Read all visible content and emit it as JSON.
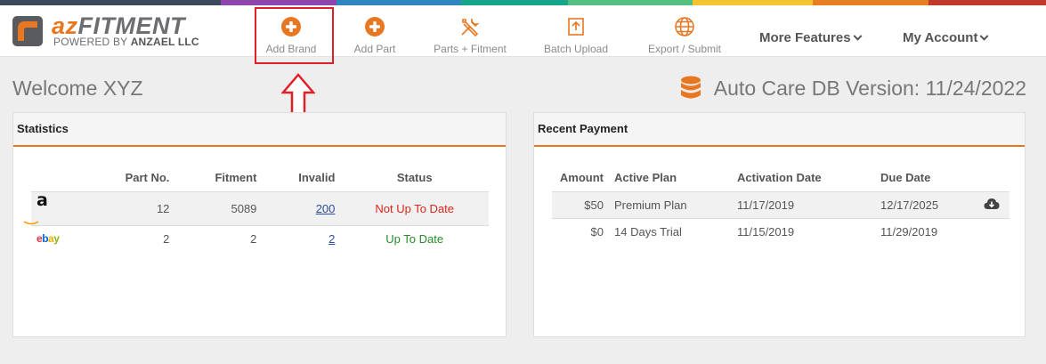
{
  "brand": {
    "logo_wordmark_az": "az",
    "logo_wordmark_rest": "FITMENT",
    "tagline_prefix": "POWERED BY",
    "tagline_company": "ANZAEL LLC",
    "accent_color": "#e87722"
  },
  "topbar_colors": [
    "#3b4a5a",
    "#8e44ad",
    "#2e86c1",
    "#17a589",
    "#52be80",
    "#f4d03f",
    "#e67e22",
    "#c0392b"
  ],
  "nav": {
    "add_brand": "Add Brand",
    "add_part": "Add Part",
    "parts_fitment": "Parts + Fitment",
    "batch_upload": "Batch Upload",
    "export_submit": "Export / Submit",
    "more_features": "More Features",
    "my_account": "My Account"
  },
  "welcome": "Welcome XYZ",
  "db_version": "Auto Care DB Version: 11/24/2022",
  "statistics": {
    "title": "Statistics",
    "headers": [
      "Part No.",
      "Fitment",
      "Invalid",
      "Status"
    ],
    "rows": [
      {
        "channel": "amazon",
        "channel_logo_text": "a",
        "part_no": "12",
        "fitment": "5089",
        "invalid": "200",
        "status": "Not Up To Date"
      },
      {
        "channel": "ebay",
        "channel_logo_text": "ebay",
        "part_no": "2",
        "fitment": "2",
        "invalid": "2",
        "status": "Up To Date"
      }
    ]
  },
  "recent_payment": {
    "title": "Recent Payment",
    "headers": [
      "Amount",
      "Active Plan",
      "Activation Date",
      "Due Date"
    ],
    "rows": [
      {
        "amount": "$50",
        "plan": "Premium Plan",
        "activation": "11/17/2019",
        "due": "12/17/2025"
      },
      {
        "amount": "$0",
        "plan": "14 Days Trial",
        "activation": "11/15/2019",
        "due": "11/29/2019"
      }
    ]
  }
}
